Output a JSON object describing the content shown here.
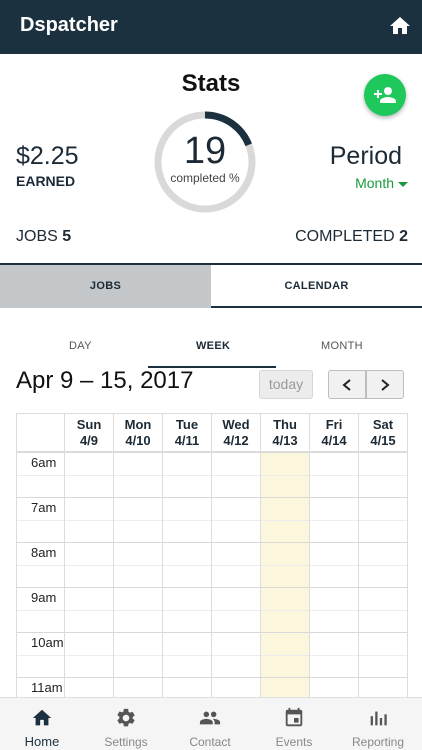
{
  "app": {
    "title": "Dspatcher"
  },
  "icons": {
    "home": "home-icon",
    "add_user": "person-add-icon",
    "settings": "gear-icon",
    "contact": "people-icon",
    "events": "calendar-icon",
    "reporting": "bar-chart-icon"
  },
  "colors": {
    "primary": "#1c3140",
    "accent": "#1ec85a",
    "period": "#1a9a3e",
    "today_column": "#fcf6dd"
  },
  "stats": {
    "title": "Stats",
    "earned_amount": "$2.25",
    "earned_label": "EARNED",
    "completed_value": "19",
    "completed_label": "completed %",
    "completed_percent": 19,
    "period_label": "Period",
    "period_value": "Month",
    "jobs_label": "JOBS",
    "jobs_count": "5",
    "completed_count_label": "COMPLETED",
    "completed_count": "2"
  },
  "tabs": [
    {
      "label": "JOBS",
      "active": false
    },
    {
      "label": "CALENDAR",
      "active": true
    }
  ],
  "calendar": {
    "views": [
      {
        "label": "DAY",
        "active": false
      },
      {
        "label": "WEEK",
        "active": true
      },
      {
        "label": "MONTH",
        "active": false
      }
    ],
    "range_title": "Apr 9 – 15, 2017",
    "today_label": "today",
    "days": [
      {
        "name": "Sun",
        "date": "4/9"
      },
      {
        "name": "Mon",
        "date": "4/10"
      },
      {
        "name": "Tue",
        "date": "4/11"
      },
      {
        "name": "Wed",
        "date": "4/12"
      },
      {
        "name": "Thu",
        "date": "4/13"
      },
      {
        "name": "Fri",
        "date": "4/14"
      },
      {
        "name": "Sat",
        "date": "4/15"
      }
    ],
    "today_index": 4,
    "times": [
      "6am",
      "7am",
      "8am",
      "9am",
      "10am",
      "11am"
    ]
  },
  "bottom_nav": [
    {
      "label": "Home",
      "icon": "home-icon",
      "active": true
    },
    {
      "label": "Settings",
      "icon": "gear-icon",
      "active": false
    },
    {
      "label": "Contact",
      "icon": "people-icon",
      "active": false
    },
    {
      "label": "Events",
      "icon": "calendar-icon",
      "active": false
    },
    {
      "label": "Reporting",
      "icon": "bar-chart-icon",
      "active": false
    }
  ]
}
